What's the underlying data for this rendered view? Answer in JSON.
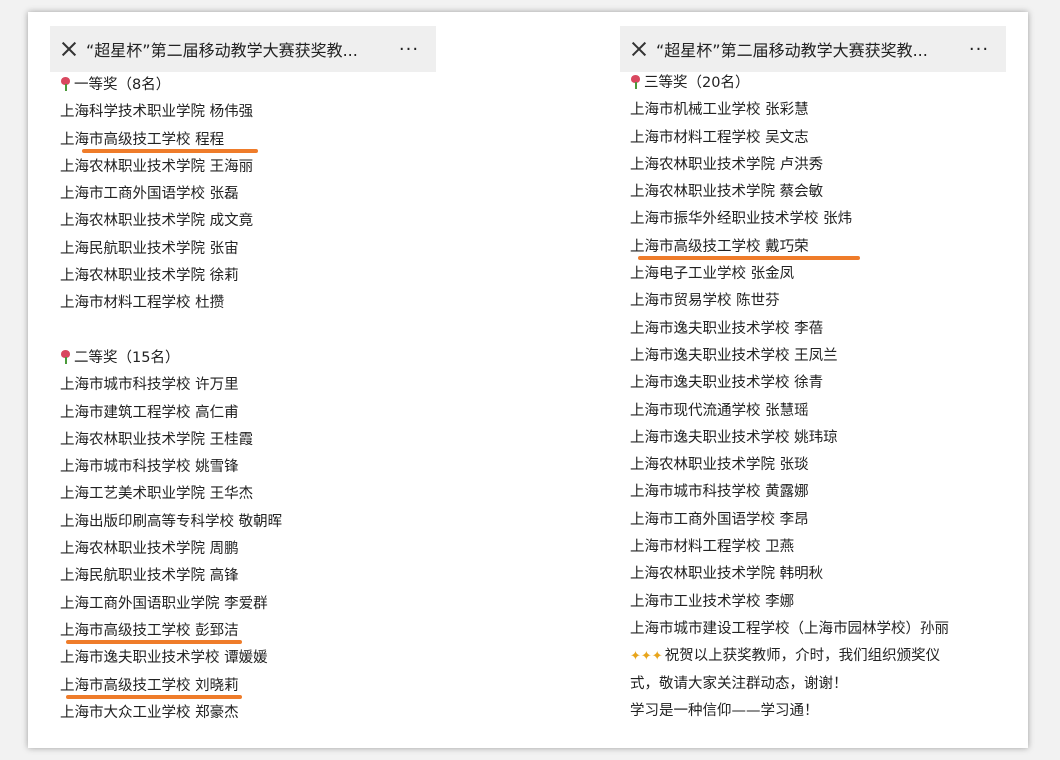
{
  "left": {
    "title": "“超星杯”第二届移动教学大赛获奖教...",
    "more": "···",
    "first_prize": {
      "heading": "一等奖（8名）",
      "winners": [
        "上海科学技术职业学院 杨伟强",
        "上海市高级技工学校 程程",
        "上海农林职业技术学院 王海丽",
        "上海市工商外国语学校 张磊",
        "上海农林职业技术学院 成文竟",
        "上海民航职业技术学院 张宙",
        "上海农林职业技术学院 徐莉",
        "上海市材料工程学校 杜攒"
      ]
    },
    "second_prize": {
      "heading": "二等奖（15名）",
      "winners": [
        "上海市城市科技学校 许万里",
        "上海市建筑工程学校 高仁甫",
        "上海农林职业技术学院 王桂霞",
        "上海市城市科技学校 姚雪锋",
        "上海工艺美术职业学院 王华杰",
        "上海出版印刷高等专科学校 敬朝晖",
        "上海农林职业技术学院 周鹏",
        "上海民航职业技术学院 高锋",
        "上海工商外国语职业学院 李爱群",
        "上海市高级技工学校 彭郅洁",
        "上海市逸夫职业技术学校 谭媛媛",
        "上海市高级技工学校 刘晓莉",
        "上海市大众工业学校 郑豪杰"
      ]
    }
  },
  "right": {
    "title": "“超星杯”第二届移动教学大赛获奖教...",
    "more": "···",
    "third_prize": {
      "heading": "三等奖（20名）",
      "winners": [
        "上海市机械工业学校 张彩慧",
        "上海市材料工程学校 吴文志",
        "上海农林职业技术学院 卢洪秀",
        "上海农林职业技术学院 蔡会敏",
        "上海市振华外经职业技术学校 张炜",
        "上海市高级技工学校 戴巧荣",
        "上海电子工业学校 张金凤",
        "上海市贸易学校 陈世芬",
        "上海市逸夫职业技术学校 李蓓",
        "上海市逸夫职业技术学校 王凤兰",
        "上海市逸夫职业技术学校 徐青",
        "上海市现代流通学校 张慧瑶",
        "上海市逸夫职业技术学校 姚玮琼",
        "上海农林职业技术学院 张琰",
        "上海市城市科技学校 黄露娜",
        "上海市工商外国语学校 李昂",
        "上海市材料工程学校 卫燕",
        "上海农林职业技术学院 韩明秋",
        "上海市工业技术学校 李娜",
        "上海市城市建设工程学校（上海市园林学校）孙丽"
      ]
    },
    "closing": {
      "line1": "祝贺以上获奖教师，介时，我们组织颁奖仪",
      "line2": "式，敬请大家关注群动态，谢谢！",
      "line3": "学习是一种信仰——学习通！"
    }
  },
  "colors": {
    "highlight": "#ef7c2a",
    "header_bg": "#efefef"
  },
  "icons": {
    "close": "close-icon",
    "more": "more-icon",
    "flower": "tulip-icon",
    "party": "party-popper-icon"
  }
}
